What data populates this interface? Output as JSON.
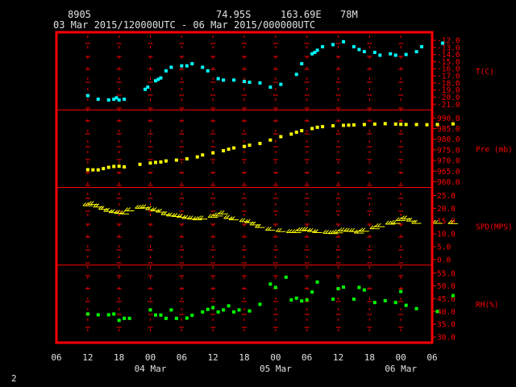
{
  "header": {
    "station_id": "8905",
    "latitude": "74.95S",
    "longitude": "163.69E",
    "elevation": "78M",
    "time_range": "03 Mar 2015/120000UTC - 06 Mar 2015/000000UTC"
  },
  "footer": {
    "page_number": "2"
  },
  "colors": {
    "frame": "#ff0000",
    "grid": "#ff0000",
    "axis_text": "#ff0000",
    "bottom_text": "#e0e0e0",
    "temperature": "#00ffff",
    "pressure": "#ffff00",
    "wind": "#ffff00",
    "humidity": "#00ff00"
  },
  "chart_data": {
    "type": "scatter",
    "x_axis": {
      "unit": "hour",
      "hour_labels": [
        "06",
        "12",
        "18",
        "00",
        "06",
        "12",
        "18",
        "00",
        "06",
        "12",
        "18",
        "00",
        "06"
      ],
      "date_labels": [
        "04 Mar",
        "05 Mar",
        "06 Mar"
      ]
    },
    "panels": [
      {
        "name": "temperature",
        "label": "T(C)",
        "ylim": [
          -21.0,
          -12.0
        ],
        "ticks": [
          "-12.0",
          "-13.0",
          "-14.0",
          "-15.0",
          "-16.0",
          "-17.0",
          "-18.0",
          "-19.0",
          "-20.0",
          "-21.0"
        ],
        "points": [
          [
            12,
            -19.8
          ],
          [
            14,
            -20.3
          ],
          [
            16,
            -20.4
          ],
          [
            17,
            -20.3
          ],
          [
            17.5,
            -20.1
          ],
          [
            18,
            -20.4
          ],
          [
            19,
            -20.3
          ],
          [
            23,
            -18.9
          ],
          [
            23.5,
            -18.6
          ],
          [
            25,
            -17.7
          ],
          [
            25.5,
            -17.5
          ],
          [
            26,
            -17.3
          ],
          [
            27,
            -16.3
          ],
          [
            28,
            -15.8
          ],
          [
            30,
            -15.6
          ],
          [
            31,
            -15.6
          ],
          [
            32,
            -15.3
          ],
          [
            34,
            -15.8
          ],
          [
            35,
            -16.3
          ],
          [
            37,
            -17.4
          ],
          [
            38,
            -17.6
          ],
          [
            40,
            -17.6
          ],
          [
            42,
            -17.8
          ],
          [
            43,
            -17.9
          ],
          [
            45,
            -18.0
          ],
          [
            47,
            -18.6
          ],
          [
            49,
            -18.2
          ],
          [
            52,
            -16.8
          ],
          [
            53,
            -15.3
          ],
          [
            55,
            -13.9
          ],
          [
            55.5,
            -13.7
          ],
          [
            56,
            -13.4
          ],
          [
            57,
            -12.9
          ],
          [
            59,
            -12.6
          ],
          [
            61,
            -12.2
          ],
          [
            63,
            -12.9
          ],
          [
            64,
            -13.3
          ],
          [
            65,
            -13.6
          ],
          [
            67,
            -13.7
          ],
          [
            68,
            -14.1
          ],
          [
            70,
            -13.9
          ],
          [
            71,
            -14.1
          ],
          [
            73,
            -14.0
          ],
          [
            75,
            -13.6
          ],
          [
            76,
            -12.9
          ],
          [
            80,
            -12.4
          ]
        ]
      },
      {
        "name": "pressure",
        "label": "Pre (mb)",
        "ylim": [
          960.0,
          990.0
        ],
        "ticks": [
          "990.0",
          "985.0",
          "980.0",
          "975.0",
          "970.0",
          "965.0",
          "960.0"
        ],
        "points": [
          [
            12,
            965.7
          ],
          [
            13,
            965.6
          ],
          [
            14,
            965.6
          ],
          [
            15,
            966.2
          ],
          [
            16,
            966.8
          ],
          [
            17,
            967.2
          ],
          [
            18,
            967.3
          ],
          [
            19,
            967.0
          ],
          [
            22,
            968.2
          ],
          [
            24,
            968.8
          ],
          [
            25,
            969.1
          ],
          [
            26,
            969.3
          ],
          [
            27,
            969.8
          ],
          [
            29,
            970.2
          ],
          [
            31,
            970.8
          ],
          [
            33,
            971.7
          ],
          [
            34,
            972.6
          ],
          [
            36,
            973.6
          ],
          [
            38,
            974.6
          ],
          [
            39,
            975.3
          ],
          [
            40,
            975.9
          ],
          [
            42,
            976.6
          ],
          [
            43,
            977.2
          ],
          [
            45,
            978.0
          ],
          [
            47,
            979.6
          ],
          [
            49,
            981.2
          ],
          [
            51,
            982.4
          ],
          [
            52,
            983.3
          ],
          [
            53,
            984.0
          ],
          [
            55,
            985.0
          ],
          [
            56,
            985.6
          ],
          [
            57,
            985.9
          ],
          [
            59,
            986.3
          ],
          [
            61,
            986.5
          ],
          [
            62,
            986.6
          ],
          [
            63,
            986.7
          ],
          [
            65,
            986.9
          ],
          [
            67,
            987.1
          ],
          [
            69,
            987.3
          ],
          [
            71,
            987.1
          ],
          [
            72,
            987.0
          ],
          [
            73,
            986.9
          ],
          [
            75,
            986.9
          ],
          [
            77,
            986.8
          ],
          [
            79,
            986.9
          ],
          [
            82,
            987.2
          ]
        ]
      },
      {
        "name": "wind",
        "label": "SPD(MPS)",
        "ylim": [
          0.0,
          25.0
        ],
        "ticks": [
          "25.0",
          "20.0",
          "15.0",
          "10.0",
          "5.0",
          "0.0"
        ],
        "points": [
          [
            12,
            21.0
          ],
          [
            13,
            21.5
          ],
          [
            14,
            20.5
          ],
          [
            15,
            19.6
          ],
          [
            16,
            18.8
          ],
          [
            17,
            18.3
          ],
          [
            18,
            18.0
          ],
          [
            19,
            17.8
          ],
          [
            20,
            19.0
          ],
          [
            22,
            20.0
          ],
          [
            23,
            20.2
          ],
          [
            24,
            19.5
          ],
          [
            25,
            19.0
          ],
          [
            26,
            18.5
          ],
          [
            27,
            17.5
          ],
          [
            28,
            17.0
          ],
          [
            29,
            16.8
          ],
          [
            30,
            16.5
          ],
          [
            31,
            16.0
          ],
          [
            32,
            15.8
          ],
          [
            33,
            15.5
          ],
          [
            34,
            15.8
          ],
          [
            36,
            16.5
          ],
          [
            37,
            17.0
          ],
          [
            38,
            17.8
          ],
          [
            39,
            16.0
          ],
          [
            40,
            15.5
          ],
          [
            42,
            14.8
          ],
          [
            43,
            14.4
          ],
          [
            44,
            13.5
          ],
          [
            45,
            12.5
          ],
          [
            47,
            11.4
          ],
          [
            49,
            10.9
          ],
          [
            51,
            10.5
          ],
          [
            52,
            10.5
          ],
          [
            53,
            11.2
          ],
          [
            54,
            11.4
          ],
          [
            55,
            10.9
          ],
          [
            56,
            10.5
          ],
          [
            58,
            10.2
          ],
          [
            59,
            10.1
          ],
          [
            60,
            10.4
          ],
          [
            61,
            11.1
          ],
          [
            62,
            11.0
          ],
          [
            63,
            10.9
          ],
          [
            64,
            10.3
          ],
          [
            65,
            11.0
          ],
          [
            67,
            12.0
          ],
          [
            68,
            12.8
          ],
          [
            70,
            13.8
          ],
          [
            71,
            14.1
          ],
          [
            72,
            15.2
          ],
          [
            73,
            15.8
          ],
          [
            74,
            15.0
          ],
          [
            75,
            14.1
          ],
          [
            79,
            14.1
          ],
          [
            82,
            14.0
          ]
        ]
      },
      {
        "name": "humidity",
        "label": "RH(%)",
        "ylim": [
          30.0,
          55.0
        ],
        "ticks": [
          "55.0",
          "50.0",
          "45.0",
          "40.0",
          "35.0",
          "30.0"
        ],
        "points": [
          [
            12,
            39.0
          ],
          [
            14,
            38.7
          ],
          [
            16,
            38.7
          ],
          [
            17,
            39.0
          ],
          [
            18,
            36.5
          ],
          [
            19,
            37.3
          ],
          [
            20,
            37.3
          ],
          [
            24,
            40.6
          ],
          [
            25,
            38.6
          ],
          [
            26,
            38.6
          ],
          [
            27,
            37.3
          ],
          [
            28,
            40.6
          ],
          [
            29,
            37.3
          ],
          [
            31,
            37.4
          ],
          [
            32,
            38.5
          ],
          [
            34,
            39.8
          ],
          [
            35,
            40.8
          ],
          [
            36,
            41.5
          ],
          [
            37,
            39.8
          ],
          [
            38,
            40.6
          ],
          [
            39,
            42.2
          ],
          [
            40,
            39.8
          ],
          [
            41,
            40.6
          ],
          [
            43,
            40.2
          ],
          [
            45,
            42.8
          ],
          [
            47,
            50.7
          ],
          [
            48,
            49.4
          ],
          [
            50,
            53.4
          ],
          [
            51,
            44.5
          ],
          [
            52,
            45.2
          ],
          [
            53,
            44.1
          ],
          [
            54,
            44.5
          ],
          [
            55,
            47.6
          ],
          [
            56,
            51.5
          ],
          [
            59,
            44.8
          ],
          [
            60,
            48.9
          ],
          [
            61,
            49.5
          ],
          [
            63,
            44.8
          ],
          [
            64,
            49.4
          ],
          [
            65,
            48.4
          ],
          [
            67,
            43.5
          ],
          [
            69,
            44.2
          ],
          [
            71,
            43.5
          ],
          [
            72,
            47.8
          ],
          [
            73,
            42.4
          ],
          [
            75,
            41.1
          ],
          [
            79,
            40.0
          ],
          [
            82,
            46.2
          ]
        ]
      }
    ]
  }
}
